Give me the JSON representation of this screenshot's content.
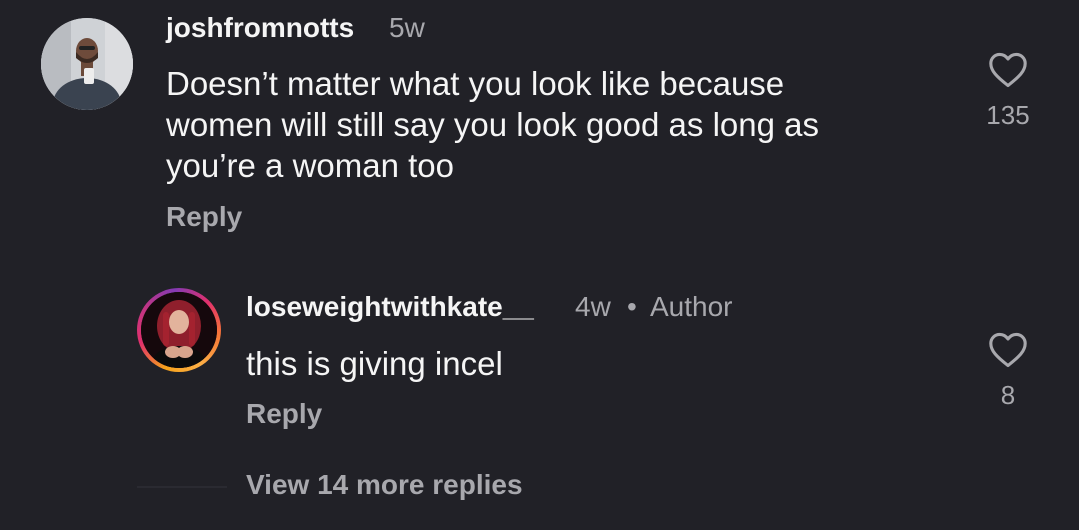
{
  "comments": [
    {
      "username": "joshfromnotts",
      "time": "5w",
      "text_lines": [
        "Doesn’t matter what you look like because",
        "women will still say you look good as long as",
        "you’re a woman too"
      ],
      "reply_label": "Reply",
      "like_count": "135",
      "like_icon": "heart-outline-icon"
    },
    {
      "username": "loseweightwithkate__",
      "time": "4w",
      "separator": "•",
      "badge": "Author",
      "text": "this is giving incel",
      "reply_label": "Reply",
      "like_count": "8",
      "like_icon": "heart-outline-icon"
    }
  ],
  "view_more_label": "View 14 more replies",
  "colors": {
    "background": "#212127",
    "primary_text": "#f5f5f5",
    "secondary_text": "#a8a8ad",
    "story_ring": [
      "#fcaf45",
      "#e1306c",
      "#833ab4"
    ]
  }
}
